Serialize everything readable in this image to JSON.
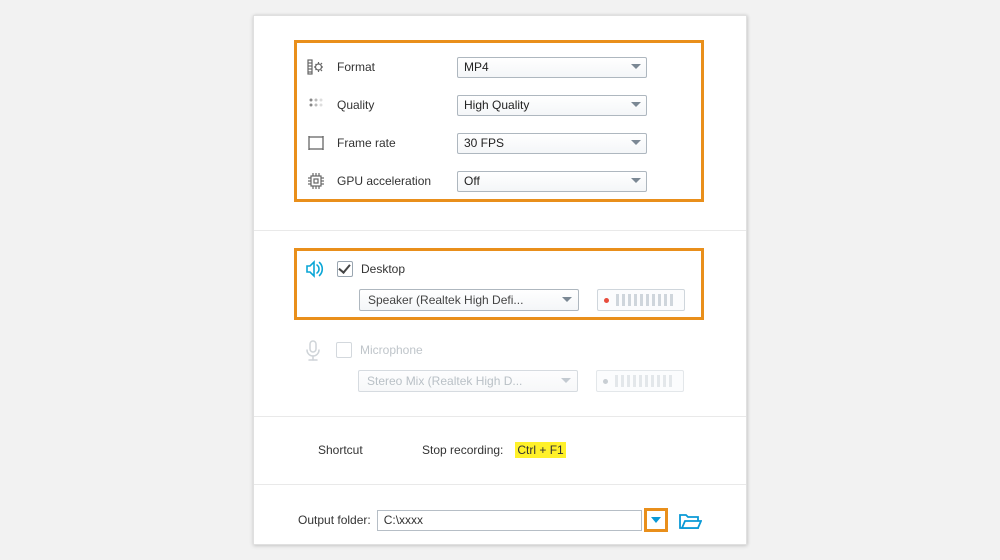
{
  "video": {
    "format_label": "Format",
    "format_value": "MP4",
    "quality_label": "Quality",
    "quality_value": "High Quality",
    "framerate_label": "Frame rate",
    "framerate_value": "30 FPS",
    "gpu_label": "GPU acceleration",
    "gpu_value": "Off"
  },
  "audio": {
    "desktop_label": "Desktop",
    "desktop_device": "Speaker (Realtek High Defi...",
    "microphone_label": "Microphone",
    "microphone_device": "Stereo Mix (Realtek High D..."
  },
  "shortcut": {
    "section_label": "Shortcut",
    "stop_label": "Stop recording:",
    "stop_keys": "Ctrl + F1"
  },
  "output": {
    "label": "Output folder:",
    "path": "C:\\xxxx"
  }
}
